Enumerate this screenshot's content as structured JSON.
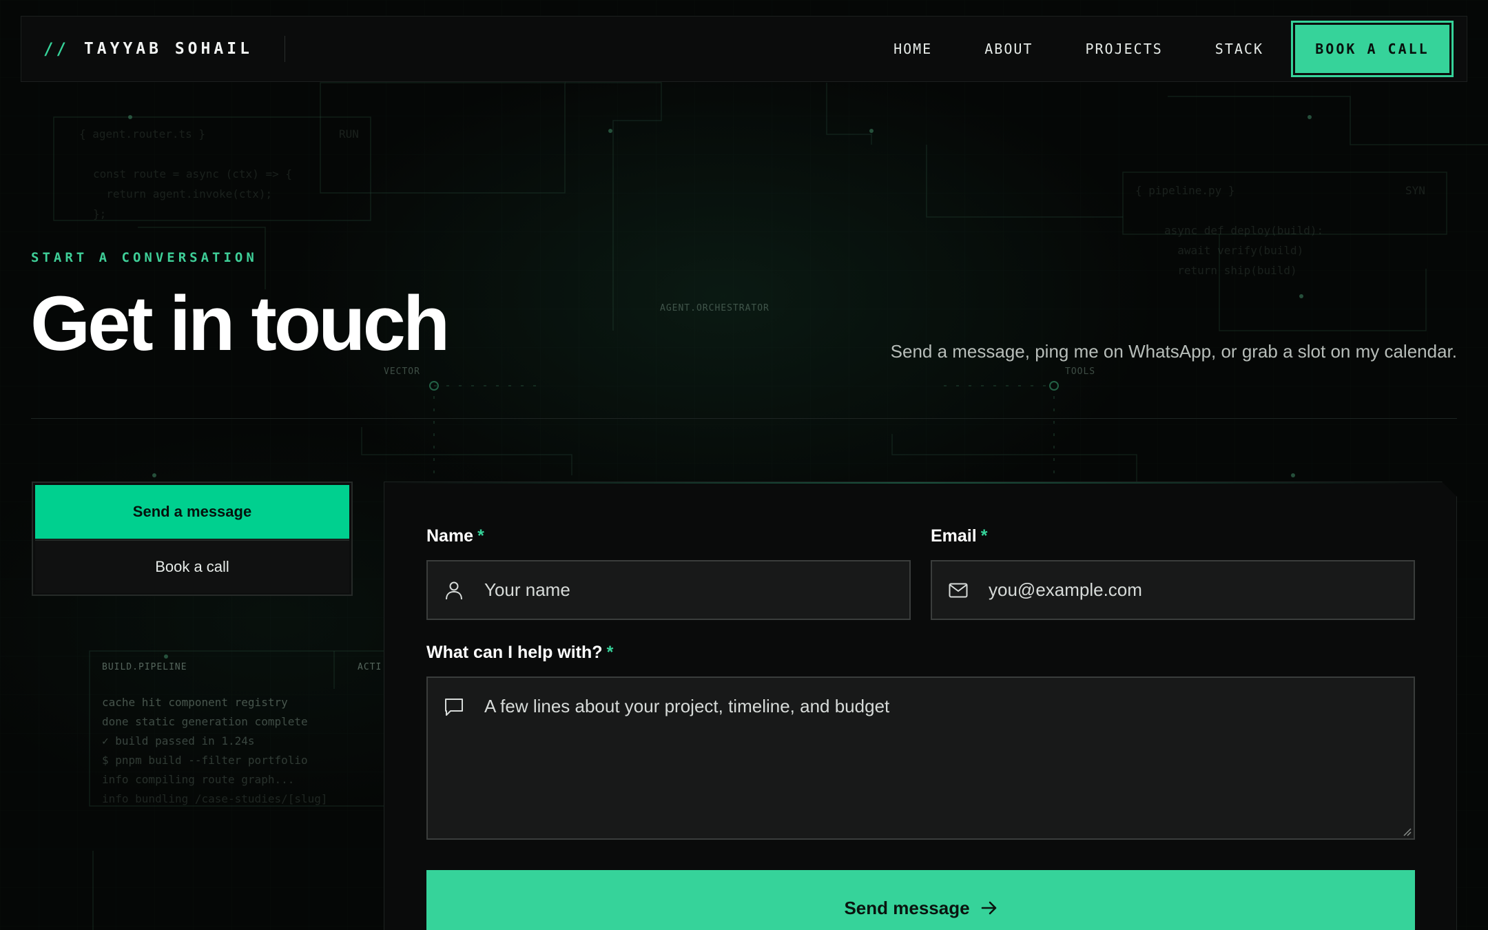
{
  "nav": {
    "brand_slashes": "//",
    "brand_name": "TAYYAB SOHAIL",
    "links": [
      "HOME",
      "ABOUT",
      "PROJECTS",
      "STACK"
    ],
    "cta_label": "BOOK A CALL"
  },
  "background_code": {
    "snippet_left_header": "{ agent.router.ts }",
    "snippet_left_tag": "RUN",
    "snippet_left_lines": [
      "const route = async (ctx) => {",
      "  return agent.invoke(ctx);",
      "};"
    ],
    "snippet_right_header": "{ pipeline.py }",
    "snippet_right_tag": "SYN",
    "snippet_right_lines": [
      "async def deploy(build):",
      "  await verify(build)",
      "  return ship(build)"
    ],
    "node_orchestrator": "AGENT.ORCHESTRATOR",
    "node_vector": "VECTOR",
    "node_tools": "TOOLS",
    "pipeline_header": "BUILD.PIPELINE",
    "pipeline_tag": "ACTI",
    "pipeline_lines": [
      "cache hit component registry",
      "done static generation complete",
      "✓ build passed in 1.24s",
      "$ pnpm build --filter portfolio",
      "info compiling route graph...",
      "info bundling /case-studies/[slug]"
    ]
  },
  "hero": {
    "eyebrow": "START A CONVERSATION",
    "title": "Get in touch",
    "subtitle": "Send a message, ping me on WhatsApp, or grab a slot on my calendar."
  },
  "toggle": {
    "active_label": "Send a message",
    "inactive_label": "Book a call"
  },
  "form": {
    "name_label": "Name",
    "name_placeholder": "Your name",
    "email_label": "Email",
    "email_placeholder": "you@example.com",
    "message_label": "What can I help with?",
    "message_placeholder": "A few lines about your project, timeline, and budget",
    "required_mark": "*",
    "submit_label": "Send message"
  },
  "colors": {
    "accent": "#36d39a",
    "accent_strong": "#00d08f",
    "background": "#050706",
    "panel": "#0a0b0b",
    "field": "#181919"
  },
  "icons": {
    "name_field": "user-icon",
    "email_field": "mail-icon",
    "message_field": "chat-bubble-icon",
    "submit": "arrow-right-icon"
  }
}
